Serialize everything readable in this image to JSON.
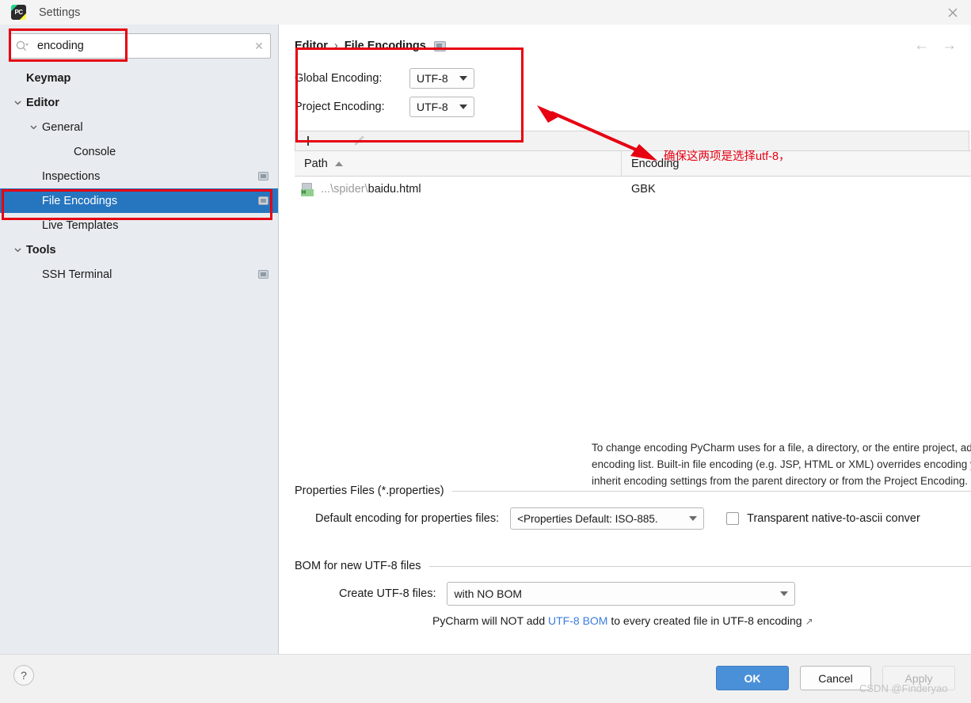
{
  "window": {
    "title": "Settings",
    "logo_icon": "pycharm-logo-icon",
    "close_icon": "close-icon"
  },
  "search": {
    "value": "encoding",
    "placeholder": "Search settings",
    "search_icon": "search-icon",
    "clear_icon": "clear-icon"
  },
  "sidebar": {
    "items": [
      {
        "label": "Keymap",
        "indent": 0,
        "bold": true,
        "arrow": "none",
        "selected": false,
        "badge": false
      },
      {
        "label": "Editor",
        "indent": 0,
        "bold": true,
        "arrow": "down",
        "selected": false,
        "badge": false
      },
      {
        "label": "General",
        "indent": 1,
        "bold": false,
        "arrow": "down",
        "selected": false,
        "badge": false
      },
      {
        "label": "Console",
        "indent": 3,
        "bold": false,
        "arrow": "none",
        "selected": false,
        "badge": false
      },
      {
        "label": "Inspections",
        "indent": 1,
        "bold": false,
        "arrow": "none",
        "selected": false,
        "badge": true
      },
      {
        "label": "File Encodings",
        "indent": 1,
        "bold": false,
        "arrow": "none",
        "selected": true,
        "badge": true
      },
      {
        "label": "Live Templates",
        "indent": 1,
        "bold": false,
        "arrow": "none",
        "selected": false,
        "badge": false
      },
      {
        "label": "Tools",
        "indent": 0,
        "bold": true,
        "arrow": "down",
        "selected": false,
        "badge": false
      },
      {
        "label": "SSH Terminal",
        "indent": 1,
        "bold": false,
        "arrow": "none",
        "selected": false,
        "badge": true
      }
    ]
  },
  "breadcrumb": {
    "parent": "Editor",
    "separator": "›",
    "current": "File Encodings",
    "badge_icon": "project-scope-badge-icon"
  },
  "nav": {
    "back_icon": "←",
    "forward_icon": "→"
  },
  "encodings": {
    "global_label": "Global Encoding:",
    "global_value": "UTF-8",
    "project_label": "Project Encoding:",
    "project_value": "UTF-8"
  },
  "toolbar": {
    "add_icon": "plus-icon",
    "remove_icon": "minus-icon",
    "edit_icon": "pencil-icon"
  },
  "table": {
    "columns": [
      "Path",
      "Encoding"
    ],
    "sort_column": "Path",
    "sort_direction": "ascending",
    "rows": [
      {
        "icon": "html-file-icon",
        "path_prefix": "...\\spider\\",
        "path_name": "baidu.html",
        "encoding": "GBK"
      }
    ]
  },
  "help_text": "To change encoding PyCharm uses for a file, a directory, or the entire project, add its path if necessary and then select encoding from encoding list. Built-in file encoding (e.g. JSP, HTML or XML) overrides encoding you specify here. If not specified, files and directories inherit encoding settings from the parent directory or from the Project Encoding.",
  "properties_section": {
    "title": "Properties Files (*.properties)",
    "default_encoding_label": "Default encoding for properties files:",
    "default_encoding_value": "<Properties Default: ISO-885.",
    "transparent_checkbox_label": "Transparent native-to-ascii conver",
    "transparent_checked": false
  },
  "bom_section": {
    "title": "BOM for new UTF-8 files",
    "create_label": "Create UTF-8 files:",
    "create_value": "with NO BOM",
    "note_before": "PyCharm will NOT add ",
    "note_link": "UTF-8 BOM",
    "note_after": " to every created file in UTF-8 encoding",
    "external_link_icon": "↗"
  },
  "footer": {
    "help_label": "?",
    "ok_label": "OK",
    "cancel_label": "Cancel",
    "apply_label": "Apply"
  },
  "annotations": {
    "note_text": "确保这两项是选择utf-8，",
    "color": "#e60012"
  },
  "watermark": "CSDN @Finderyao"
}
